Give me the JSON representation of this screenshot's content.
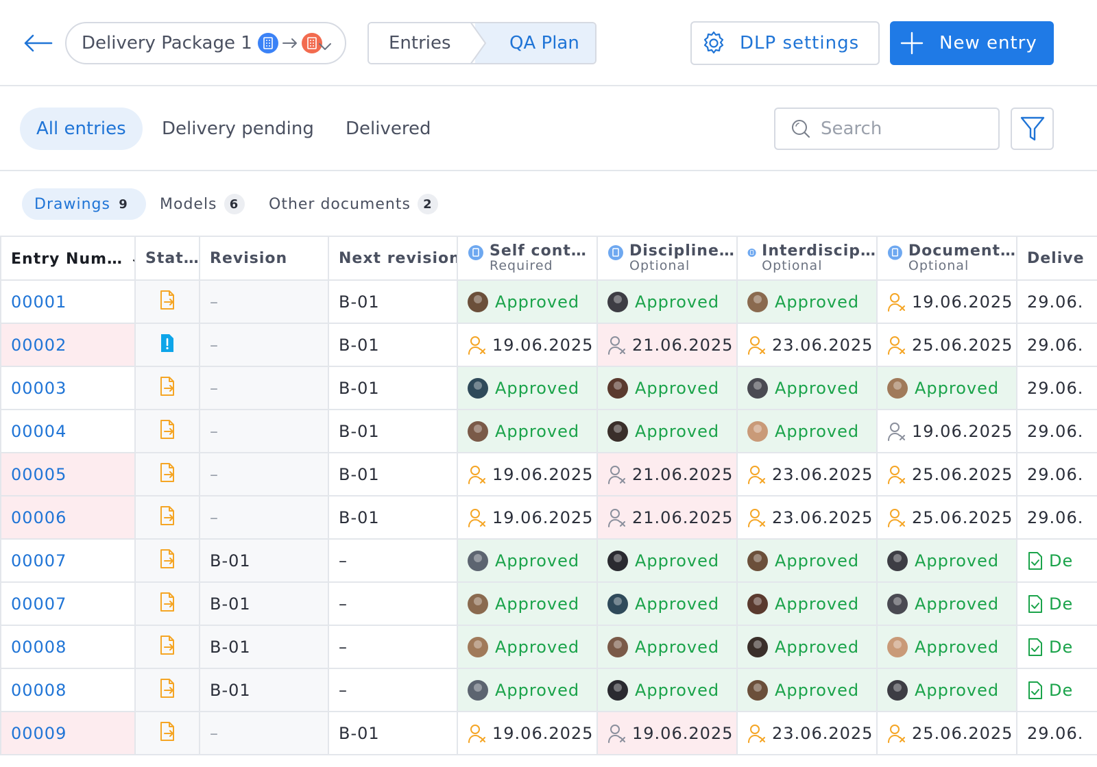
{
  "header": {
    "package_label": "Delivery Package 1",
    "breadcrumb": [
      "Entries",
      "QA Plan"
    ],
    "dlp_settings": "DLP settings",
    "new_entry": "New entry"
  },
  "filters": {
    "tabs": [
      "All entries",
      "Delivery pending",
      "Delivered"
    ],
    "active": "All entries",
    "search_placeholder": "Search"
  },
  "doc_tabs": [
    {
      "label": "Drawings",
      "count": "9"
    },
    {
      "label": "Models",
      "count": "6"
    },
    {
      "label": "Other documents",
      "count": "2"
    }
  ],
  "table": {
    "columns": {
      "entry_number": "Entry Num…",
      "status": "Stat…",
      "revision": "Revision",
      "next_revision": "Next revision",
      "check_1": {
        "title": "Self cont…",
        "sub": "Required"
      },
      "check_2": {
        "title": "Discipline…",
        "sub": "Optional"
      },
      "check_3": {
        "title": "Interdiscip…",
        "sub": "Optional"
      },
      "check_4": {
        "title": "Document…",
        "sub": "Optional"
      },
      "delivery": "Delive"
    },
    "rows": [
      {
        "num": "00001",
        "alert": false,
        "status": "doc",
        "rev": "–",
        "next": "B-01",
        "checks": [
          {
            "t": "Approved",
            "s": "approved"
          },
          {
            "t": "Approved",
            "s": "approved"
          },
          {
            "t": "Approved",
            "s": "approved"
          },
          {
            "t": "19.06.2025",
            "s": "pending"
          }
        ],
        "deliv": "29.06."
      },
      {
        "num": "00002",
        "alert": true,
        "status": "alert",
        "rev": "–",
        "next": "B-01",
        "checks": [
          {
            "t": "19.06.2025",
            "s": "pending"
          },
          {
            "t": "21.06.2025",
            "s": "waiting"
          },
          {
            "t": "23.06.2025",
            "s": "pending"
          },
          {
            "t": "25.06.2025",
            "s": "pending"
          }
        ],
        "deliv": "29.06."
      },
      {
        "num": "00003",
        "alert": false,
        "status": "doc",
        "rev": "–",
        "next": "B-01",
        "checks": [
          {
            "t": "Approved",
            "s": "approved"
          },
          {
            "t": "Approved",
            "s": "approved"
          },
          {
            "t": "Approved",
            "s": "approved"
          },
          {
            "t": "Approved",
            "s": "approved"
          }
        ],
        "deliv": "29.06."
      },
      {
        "num": "00004",
        "alert": false,
        "status": "doc",
        "rev": "–",
        "next": "B-01",
        "checks": [
          {
            "t": "Approved",
            "s": "approved"
          },
          {
            "t": "Approved",
            "s": "approved"
          },
          {
            "t": "Approved",
            "s": "approved"
          },
          {
            "t": "19.06.2025",
            "s": "idle"
          }
        ],
        "deliv": "29.06."
      },
      {
        "num": "00005",
        "alert": true,
        "status": "doc",
        "rev": "–",
        "next": "B-01",
        "checks": [
          {
            "t": "19.06.2025",
            "s": "pending"
          },
          {
            "t": "21.06.2025",
            "s": "waiting"
          },
          {
            "t": "23.06.2025",
            "s": "pending"
          },
          {
            "t": "25.06.2025",
            "s": "pending"
          }
        ],
        "deliv": "29.06."
      },
      {
        "num": "00006",
        "alert": true,
        "status": "doc",
        "rev": "–",
        "next": "B-01",
        "checks": [
          {
            "t": "19.06.2025",
            "s": "pending"
          },
          {
            "t": "21.06.2025",
            "s": "waiting"
          },
          {
            "t": "23.06.2025",
            "s": "pending"
          },
          {
            "t": "25.06.2025",
            "s": "pending"
          }
        ],
        "deliv": "29.06."
      },
      {
        "num": "00007",
        "alert": false,
        "status": "doc",
        "rev": "B-01",
        "next": "–",
        "checks": [
          {
            "t": "Approved",
            "s": "approved"
          },
          {
            "t": "Approved",
            "s": "approved"
          },
          {
            "t": "Approved",
            "s": "approved"
          },
          {
            "t": "Approved",
            "s": "approved"
          }
        ],
        "deliv": "De"
      },
      {
        "num": "00007",
        "alert": false,
        "status": "doc",
        "rev": "B-01",
        "next": "–",
        "checks": [
          {
            "t": "Approved",
            "s": "approved"
          },
          {
            "t": "Approved",
            "s": "approved"
          },
          {
            "t": "Approved",
            "s": "approved"
          },
          {
            "t": "Approved",
            "s": "approved"
          }
        ],
        "deliv": "De"
      },
      {
        "num": "00008",
        "alert": false,
        "status": "doc",
        "rev": "B-01",
        "next": "–",
        "checks": [
          {
            "t": "Approved",
            "s": "approved"
          },
          {
            "t": "Approved",
            "s": "approved"
          },
          {
            "t": "Approved",
            "s": "approved"
          },
          {
            "t": "Approved",
            "s": "approved"
          }
        ],
        "deliv": "De"
      },
      {
        "num": "00008",
        "alert": false,
        "status": "doc",
        "rev": "B-01",
        "next": "–",
        "checks": [
          {
            "t": "Approved",
            "s": "approved"
          },
          {
            "t": "Approved",
            "s": "approved"
          },
          {
            "t": "Approved",
            "s": "approved"
          },
          {
            "t": "Approved",
            "s": "approved"
          }
        ],
        "deliv": "De"
      },
      {
        "num": "00009",
        "alert": true,
        "status": "doc",
        "rev": "–",
        "next": "B-01",
        "checks": [
          {
            "t": "19.06.2025",
            "s": "pending"
          },
          {
            "t": "19.06.2025",
            "s": "waiting"
          },
          {
            "t": "23.06.2025",
            "s": "pending"
          },
          {
            "t": "25.06.2025",
            "s": "pending"
          }
        ],
        "deliv": "29.06."
      }
    ]
  },
  "colors": {
    "accent": "#1f7ae6",
    "approved": "#1aa34a",
    "pending_icon": "#f59e0b",
    "alert_row": "#fdecef"
  }
}
